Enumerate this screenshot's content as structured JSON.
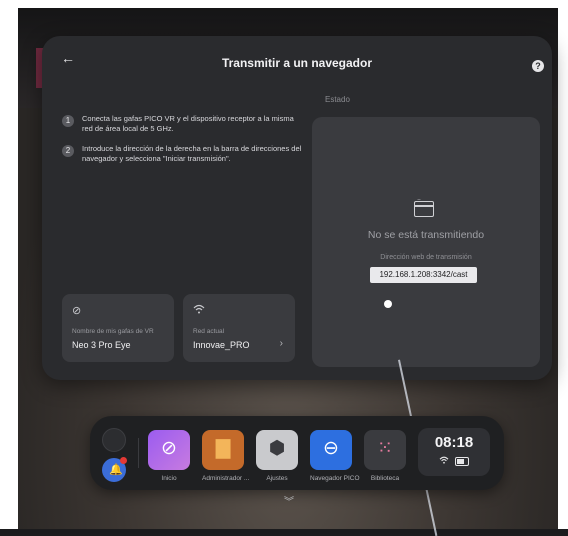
{
  "panel": {
    "title": "Transmitir a un navegador",
    "back_icon": "←",
    "help_icon": "?",
    "steps": [
      {
        "num": "1",
        "text": "Conecta las gafas PICO VR y el dispositivo receptor a la misma red de área local de 5 GHz."
      },
      {
        "num": "2",
        "text": "Introduce la dirección de la derecha en la barra de direcciones del navegador y selecciona \"Iniciar transmisión\"."
      }
    ],
    "state_label": "Estado",
    "status_text": "No se está transmitiendo",
    "address_label": "Dirección web de transmisión",
    "address_value": "192.168.1.208:3342/cast",
    "name_card": {
      "icon": "⊘",
      "label": "Nombre de mis gafas de VR",
      "value": "Neo 3 Pro Eye"
    },
    "network_card": {
      "icon": "wifi-icon",
      "label": "Red actual",
      "value": "Innovae_PRO",
      "chevron": "›"
    }
  },
  "dock": {
    "apps": [
      {
        "label": "Inicio",
        "glyph": "⊘"
      },
      {
        "label": "Administrador ...",
        "glyph": "▇"
      },
      {
        "label": "Ajustes",
        "glyph": "⬢"
      },
      {
        "label": "Navegador PICO",
        "glyph": "⊖"
      },
      {
        "label": "Biblioteca",
        "glyph": "⁙"
      }
    ],
    "clock": "08:18",
    "chevron": "︾"
  },
  "colors": {
    "panel_bg": "#2a2b2e",
    "card_bg": "#3a3b3f",
    "accent_blue": "#2d6fe0",
    "inicio_purple": "#9b5cf0",
    "admin_orange": "#c46a2a",
    "badge_red": "#e53935"
  }
}
